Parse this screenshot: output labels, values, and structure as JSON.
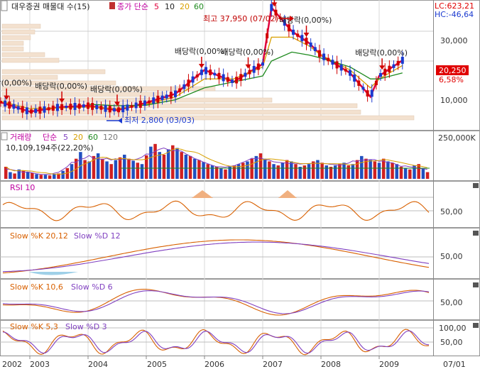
{
  "header": {
    "stock_label": "대우증권 매물대 수(15)",
    "ma_label": "종가 단순",
    "ma_periods": [
      "5",
      "10",
      "20",
      "60"
    ],
    "ma_colors": [
      "#e0003c",
      "#222222",
      "#d8a000",
      "#1e8a1e"
    ],
    "lc_label": "LC:623,21",
    "hc_label": "HC:-46,64"
  },
  "price_panel": {
    "high_annotation": "최고 37,950 (07/02)",
    "low_annotation": "최저 2,800 (03/03)",
    "dividend_label": "배당락(0,00%)",
    "current_price": "20,250",
    "current_change": "6,58%",
    "y_ticks": [
      "30,000",
      "20,000",
      "10,000"
    ]
  },
  "volume_panel": {
    "title": "거래량",
    "ma_label": "단순",
    "ma_periods": [
      "5",
      "20",
      "60",
      "120"
    ],
    "ma_colors": [
      "#8040c0",
      "#d8a000",
      "#1e8a1e",
      "#777777"
    ],
    "last_value": "10,109,194주(22,20%)",
    "y_tick": "250,000K"
  },
  "rsi_panel": {
    "title": "RSI 10",
    "y_tick": "50,00"
  },
  "slow1_panel": {
    "title_k": "Slow %K 20,12",
    "title_d": "Slow %D 12",
    "y_tick": "50,00"
  },
  "slow2_panel": {
    "title_k": "Slow %K 10,6",
    "title_d": "Slow %D 6",
    "y_tick": "50,00"
  },
  "slow3_panel": {
    "title_k": "Slow %K 5,3",
    "title_d": "Slow %D 3",
    "y_ticks": [
      "100,00",
      "50,00"
    ]
  },
  "x_axis": {
    "labels": [
      "2002",
      "2003",
      "2004",
      "2005",
      "2006",
      "2007",
      "2008",
      "2009"
    ],
    "right_label": "07/01"
  },
  "chart_data": {
    "type": "line",
    "title": "대우증권 매물대 수(15)",
    "x_range": [
      "2002",
      "2009"
    ],
    "y_range_price": [
      0,
      40000
    ],
    "highlights": {
      "high": {
        "date": "07/02",
        "value": 37950
      },
      "low": {
        "date": "03/03",
        "value": 2800
      },
      "last": {
        "value": 20250,
        "change_pct": 6.58
      }
    },
    "x_years": [
      2002,
      2002.5,
      2003,
      2003.5,
      2004,
      2004.5,
      2005,
      2005.5,
      2006,
      2006.5,
      2007,
      2007.15,
      2007.5,
      2007.8,
      2008,
      2008.5,
      2008.85,
      2009,
      2009.4
    ],
    "series": [
      {
        "name": "종가",
        "color": "#e0003c",
        "values": [
          7000,
          6200,
          3000,
          4500,
          5000,
          3500,
          6000,
          9000,
          17000,
          13000,
          19000,
          37950,
          30000,
          26000,
          22000,
          16000,
          8000,
          15000,
          20250
        ]
      },
      {
        "name": "20",
        "color": "#d8a000",
        "values": [
          7500,
          6500,
          4000,
          4200,
          4600,
          4000,
          5500,
          8000,
          14000,
          14000,
          18000,
          28000,
          28000,
          25000,
          22000,
          17000,
          11000,
          14000,
          18500
        ]
      },
      {
        "name": "60",
        "color": "#1e8a1e",
        "values": [
          null,
          null,
          null,
          null,
          5500,
          5000,
          5200,
          7000,
          11000,
          13000,
          15000,
          20000,
          23000,
          22000,
          21000,
          18000,
          14000,
          14000,
          16000
        ]
      }
    ],
    "dividend_events": [
      2002.6,
      2003.55,
      2004.5,
      2005.95,
      2006.75,
      2007.2,
      2007.75,
      2009.05
    ],
    "volume_bars": [
      18,
      10,
      8,
      14,
      12,
      10,
      9,
      7,
      6,
      6,
      5,
      7,
      8,
      12,
      16,
      22,
      30,
      40,
      28,
      26,
      34,
      38,
      30,
      26,
      22,
      28,
      32,
      36,
      30,
      27,
      24,
      22,
      35,
      48,
      52,
      40,
      36,
      44,
      50,
      46,
      40,
      36,
      34,
      30,
      28,
      25,
      22,
      20,
      18,
      16,
      14,
      18,
      20,
      22,
      24,
      26,
      30,
      34,
      38,
      30,
      26,
      22,
      20,
      24,
      28,
      26,
      22,
      18,
      20,
      22,
      26,
      28,
      24,
      20,
      18,
      20,
      22,
      24,
      20,
      22,
      28,
      34,
      30,
      28,
      26,
      24,
      30,
      26,
      24,
      22,
      18,
      16,
      14,
      20,
      22,
      16,
      10
    ],
    "volume_colors": "alternating red/blue"
  }
}
